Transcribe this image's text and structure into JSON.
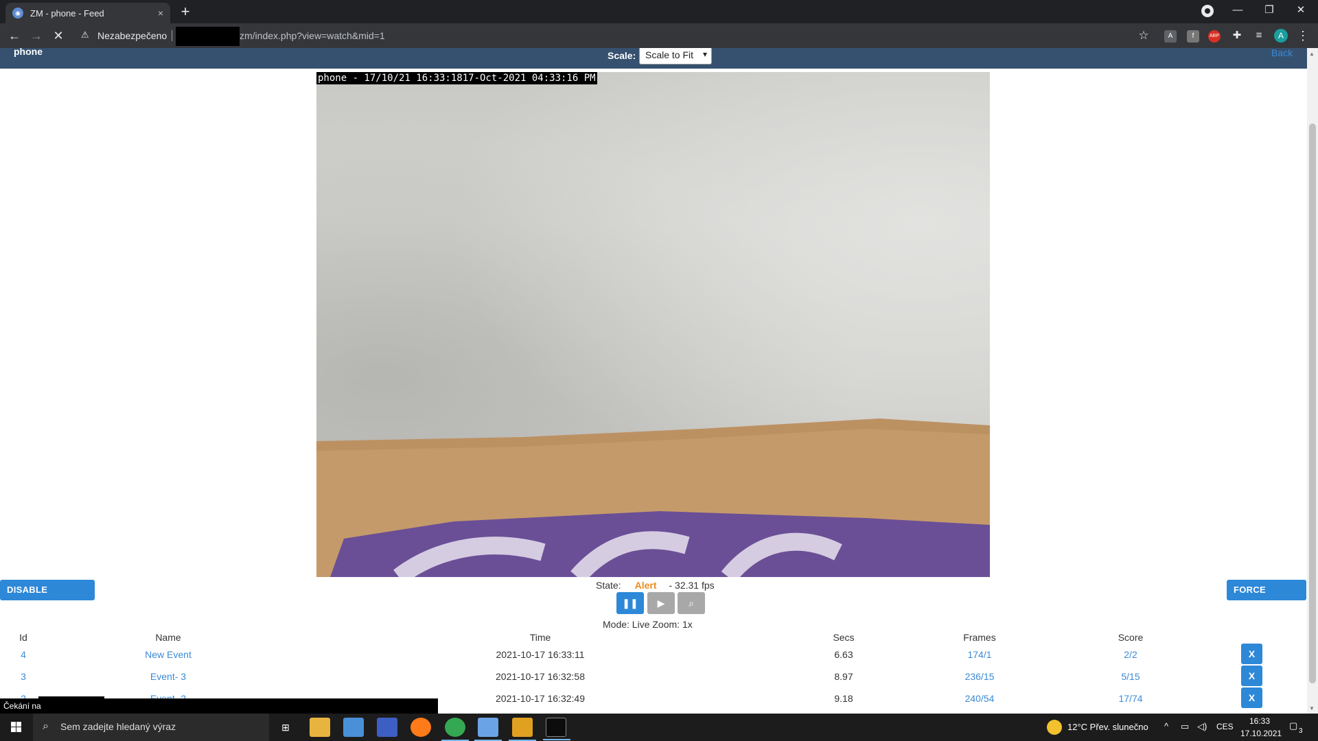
{
  "browser": {
    "tab_title": "ZM - phone - Feed",
    "tab_close": "×",
    "new_tab": "+",
    "security_label": "Nezabezpečeno",
    "url": "zm/index.php?view=watch&mid=1",
    "icons": [
      "back-icon",
      "forward-icon",
      "stop-icon",
      "warning-icon",
      "star-icon",
      "extensions-icon",
      "media-icon",
      "profile-icon",
      "menu-icon"
    ],
    "profile_initial": "A",
    "ext_abp": "ABP"
  },
  "header": {
    "monitor_name": "phone",
    "scale_label": "Scale:",
    "scale_value": "Scale to Fit",
    "back_link": "Back"
  },
  "feed": {
    "overlay_text": "phone - 17/10/21 16:33:1817-Oct-2021 04:33:16 PM"
  },
  "controls": {
    "disable_alarms": "DISABLE ALARMS",
    "force_alarm": "FORCE ALARM",
    "state_label": "State:",
    "state_value": "Alert",
    "fps": "- 32.31 fps",
    "mode_line": "Mode: Live   Zoom: 1x",
    "state_color": "#e88c1f"
  },
  "events": {
    "columns": [
      "Id",
      "Name",
      "Time",
      "Secs",
      "Frames",
      "Score"
    ],
    "rows": [
      {
        "id": "4",
        "name": "New Event",
        "time": "2021-10-17 16:33:11",
        "secs": "6.63",
        "frames": "174/1",
        "score": "2/2",
        "delete": "X"
      },
      {
        "id": "3",
        "name": "Event- 3",
        "time": "2021-10-17 16:32:58",
        "secs": "8.97",
        "frames": "236/15",
        "score": "5/15",
        "delete": "X"
      },
      {
        "id": "2",
        "name": "Event- 2",
        "time": "2021-10-17 16:32:49",
        "secs": "9.18",
        "frames": "240/54",
        "score": "17/74",
        "delete": "X"
      }
    ]
  },
  "status_tip": "Čekání na",
  "taskbar": {
    "search_placeholder": "Sem zadejte hledaný výraz",
    "weather": "12°C  Přev. slunečno",
    "language": "CES",
    "time": "16:33",
    "date": "17.10.2021",
    "notifications": "3"
  },
  "colors": {
    "header_bg": "#36516f",
    "accent": "#2d88d8",
    "link": "#3a8ad6"
  }
}
